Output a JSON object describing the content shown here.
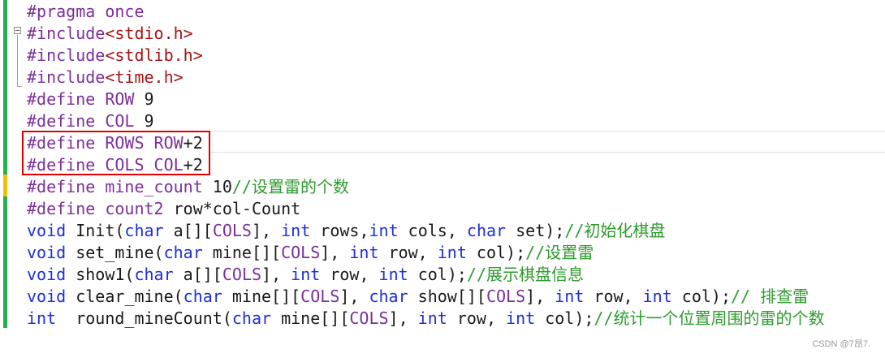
{
  "colors": {
    "preprocessor": "#7b2f9a",
    "keyword": "#1d2fd8",
    "string": "#a31515",
    "comment": "#2e9b2e",
    "change_bar_green": "#22b14c",
    "change_bar_yellow": "#f0c000",
    "highlight": "#e00000"
  },
  "lines": [
    {
      "tokens": [
        {
          "t": "pp",
          "v": "#pragma once"
        }
      ]
    },
    {
      "tokens": [
        {
          "t": "pp",
          "v": "#include"
        },
        {
          "t": "str",
          "v": "<stdio.h>"
        }
      ]
    },
    {
      "tokens": [
        {
          "t": "pp",
          "v": "#include"
        },
        {
          "t": "str",
          "v": "<stdlib.h>"
        }
      ]
    },
    {
      "tokens": [
        {
          "t": "pp",
          "v": "#include"
        },
        {
          "t": "str",
          "v": "<time.h>"
        }
      ]
    },
    {
      "tokens": [
        {
          "t": "pp",
          "v": "#define "
        },
        {
          "t": "mac",
          "v": "ROW"
        },
        {
          "t": "txt",
          "v": " 9"
        }
      ]
    },
    {
      "tokens": [
        {
          "t": "pp",
          "v": "#define "
        },
        {
          "t": "mac",
          "v": "COL"
        },
        {
          "t": "txt",
          "v": " 9"
        }
      ]
    },
    {
      "tokens": [
        {
          "t": "pp",
          "v": "#define "
        },
        {
          "t": "mac",
          "v": "ROWS ROW"
        },
        {
          "t": "txt",
          "v": "+2"
        }
      ]
    },
    {
      "tokens": [
        {
          "t": "pp",
          "v": "#define "
        },
        {
          "t": "mac",
          "v": "COLS COL"
        },
        {
          "t": "txt",
          "v": "+2"
        }
      ]
    },
    {
      "tokens": [
        {
          "t": "pp",
          "v": "#define "
        },
        {
          "t": "mac",
          "v": "mine_count"
        },
        {
          "t": "txt",
          "v": " 10"
        },
        {
          "t": "cm",
          "v": "//设置雷的个数"
        }
      ]
    },
    {
      "tokens": [
        {
          "t": "pp",
          "v": "#define "
        },
        {
          "t": "mac",
          "v": "count2"
        },
        {
          "t": "txt",
          "v": " row*col-Count"
        }
      ]
    },
    {
      "tokens": [
        {
          "t": "kw",
          "v": "void"
        },
        {
          "t": "txt",
          "v": " Init("
        },
        {
          "t": "kw",
          "v": "char"
        },
        {
          "t": "txt",
          "v": " a[]["
        },
        {
          "t": "mac",
          "v": "COLS"
        },
        {
          "t": "txt",
          "v": "], "
        },
        {
          "t": "kw",
          "v": "int"
        },
        {
          "t": "txt",
          "v": " rows,"
        },
        {
          "t": "kw",
          "v": "int"
        },
        {
          "t": "txt",
          "v": " cols, "
        },
        {
          "t": "kw",
          "v": "char"
        },
        {
          "t": "txt",
          "v": " set);"
        },
        {
          "t": "cm",
          "v": "//初始化棋盘"
        }
      ]
    },
    {
      "tokens": [
        {
          "t": "kw",
          "v": "void"
        },
        {
          "t": "txt",
          "v": " set_mine("
        },
        {
          "t": "kw",
          "v": "char"
        },
        {
          "t": "txt",
          "v": " mine[]["
        },
        {
          "t": "mac",
          "v": "COLS"
        },
        {
          "t": "txt",
          "v": "], "
        },
        {
          "t": "kw",
          "v": "int"
        },
        {
          "t": "txt",
          "v": " row, "
        },
        {
          "t": "kw",
          "v": "int"
        },
        {
          "t": "txt",
          "v": " col);"
        },
        {
          "t": "cm",
          "v": "//设置雷"
        }
      ]
    },
    {
      "tokens": [
        {
          "t": "kw",
          "v": "void"
        },
        {
          "t": "txt",
          "v": " show1("
        },
        {
          "t": "kw",
          "v": "char"
        },
        {
          "t": "txt",
          "v": " a[]["
        },
        {
          "t": "mac",
          "v": "COLS"
        },
        {
          "t": "txt",
          "v": "], "
        },
        {
          "t": "kw",
          "v": "int"
        },
        {
          "t": "txt",
          "v": " row, "
        },
        {
          "t": "kw",
          "v": "int"
        },
        {
          "t": "txt",
          "v": " col);"
        },
        {
          "t": "cm",
          "v": "//展示棋盘信息"
        }
      ]
    },
    {
      "tokens": [
        {
          "t": "kw",
          "v": "void"
        },
        {
          "t": "txt",
          "v": " clear_mine("
        },
        {
          "t": "kw",
          "v": "char"
        },
        {
          "t": "txt",
          "v": " mine[]["
        },
        {
          "t": "mac",
          "v": "COLS"
        },
        {
          "t": "txt",
          "v": "], "
        },
        {
          "t": "kw",
          "v": "char"
        },
        {
          "t": "txt",
          "v": " show[]["
        },
        {
          "t": "mac",
          "v": "COLS"
        },
        {
          "t": "txt",
          "v": "], "
        },
        {
          "t": "kw",
          "v": "int"
        },
        {
          "t": "txt",
          "v": " row, "
        },
        {
          "t": "kw",
          "v": "int"
        },
        {
          "t": "txt",
          "v": " col);"
        },
        {
          "t": "cm",
          "v": "// 排查雷"
        }
      ]
    },
    {
      "tokens": [
        {
          "t": "kw",
          "v": "int"
        },
        {
          "t": "txt",
          "v": "  round_mineCount("
        },
        {
          "t": "kw",
          "v": "char"
        },
        {
          "t": "txt",
          "v": " mine[]["
        },
        {
          "t": "mac",
          "v": "COLS"
        },
        {
          "t": "txt",
          "v": "], "
        },
        {
          "t": "kw",
          "v": "int"
        },
        {
          "t": "txt",
          "v": " row, "
        },
        {
          "t": "kw",
          "v": "int"
        },
        {
          "t": "txt",
          "v": " col);"
        },
        {
          "t": "cm",
          "v": "//统计一个位置周围的雷的个数"
        }
      ]
    }
  ],
  "watermark": "CSDN @7昂7."
}
